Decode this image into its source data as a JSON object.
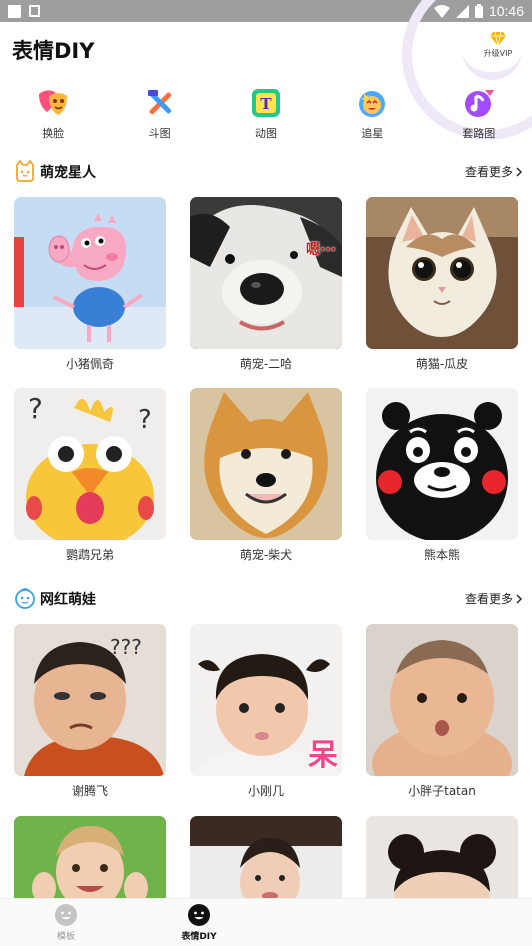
{
  "status_bar": {
    "time": "10:46"
  },
  "header": {
    "title": "表情DIY",
    "vip_label": "升级VIP"
  },
  "tools": [
    {
      "label": "换脸",
      "icon": "mask-icon"
    },
    {
      "label": "斗图",
      "icon": "tools-icon"
    },
    {
      "label": "动图",
      "icon": "gif-text-icon"
    },
    {
      "label": "追星",
      "icon": "star-fan-icon"
    },
    {
      "label": "套路图",
      "icon": "music-note-icon"
    }
  ],
  "sections": [
    {
      "title": "萌宠星人",
      "more": "查看更多",
      "items": [
        {
          "label": "小猪佩奇",
          "overlay": ""
        },
        {
          "label": "萌宠-二哈",
          "overlay": "嗯···"
        },
        {
          "label": "萌猫-瓜皮",
          "overlay": ""
        },
        {
          "label": "鹦鹉兄弟",
          "overlay": ""
        },
        {
          "label": "萌宠-柴犬",
          "overlay": ""
        },
        {
          "label": "熊本熊",
          "overlay": ""
        }
      ]
    },
    {
      "title": "网红萌娃",
      "more": "查看更多",
      "items": [
        {
          "label": "谢腾飞",
          "overlay": ""
        },
        {
          "label": "小刚几",
          "overlay": "呆"
        },
        {
          "label": "小胖子tatan",
          "overlay": ""
        },
        {
          "label": "",
          "overlay": ""
        },
        {
          "label": "",
          "overlay": ""
        },
        {
          "label": "",
          "overlay": ""
        }
      ]
    }
  ],
  "bottom_nav": [
    {
      "label": "模板",
      "active": false
    },
    {
      "label": "表情DIY",
      "active": true
    }
  ],
  "colors": {
    "accent": "#111111",
    "inactive": "#9a9a9a",
    "vip": "#f5b800"
  }
}
